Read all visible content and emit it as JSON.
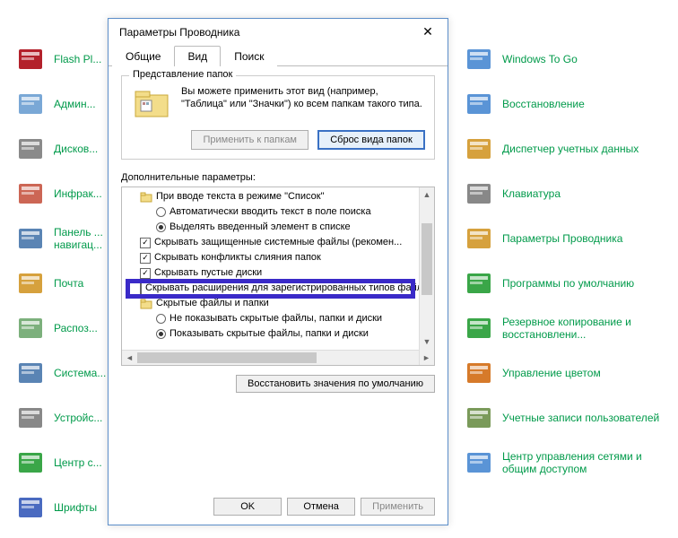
{
  "bg_left": [
    {
      "label": "Flash Pl...",
      "icon": "flash"
    },
    {
      "label": "Админ...",
      "icon": "admin"
    },
    {
      "label": "Дисков...",
      "icon": "disk"
    },
    {
      "label": "Инфрак...",
      "icon": "infra"
    },
    {
      "label": "Панель ...\nнавигац...",
      "icon": "taskbar"
    },
    {
      "label": "Почта",
      "icon": "mail"
    },
    {
      "label": "Распоз...",
      "icon": "speech"
    },
    {
      "label": "Системa...",
      "icon": "system"
    },
    {
      "label": "Устройс...",
      "icon": "device"
    },
    {
      "label": "Центр с...",
      "icon": "sync"
    },
    {
      "label": "Шрифты",
      "icon": "fonts"
    }
  ],
  "bg_right": [
    {
      "label": "Windows To Go",
      "icon": "wtg"
    },
    {
      "label": "Восстановление",
      "icon": "recovery"
    },
    {
      "label": "Диспетчер учетных данных",
      "icon": "cred"
    },
    {
      "label": "Клавиатура",
      "icon": "kbd"
    },
    {
      "label": "Параметры Проводника",
      "icon": "explorer"
    },
    {
      "label": "Программы по умолчанию",
      "icon": "default"
    },
    {
      "label": "Резервное копирование и восстановлени...",
      "icon": "backup"
    },
    {
      "label": "Управление цветом",
      "icon": "color"
    },
    {
      "label": "Учетные записи пользователей",
      "icon": "users"
    },
    {
      "label": "Центр управления сетями и общим доступом",
      "icon": "network"
    }
  ],
  "dialog": {
    "title": "Параметры Проводника",
    "tabs": [
      "Общие",
      "Вид",
      "Поиск"
    ],
    "folder_views": {
      "legend": "Представление папок",
      "text": "Вы можете применить этот вид (например, \"Таблица\" или \"Значки\") ко всем папкам такого типа.",
      "apply_btn": "Применить к папкам",
      "reset_btn": "Сброс вида папок"
    },
    "adv_label": "Дополнительные параметры:",
    "tree": [
      {
        "type": "folder",
        "indent": 1,
        "text": "При вводе текста в режиме \"Список\""
      },
      {
        "type": "radio",
        "indent": 2,
        "sel": false,
        "text": "Автоматически вводить текст в поле поиска"
      },
      {
        "type": "radio",
        "indent": 2,
        "sel": true,
        "text": "Выделять введенный элемент в списке"
      },
      {
        "type": "check",
        "indent": 1,
        "sel": true,
        "text": "Скрывать защищенные системные файлы (рекомен..."
      },
      {
        "type": "check",
        "indent": 1,
        "sel": true,
        "text": "Скрывать конфликты слияния папок"
      },
      {
        "type": "check",
        "indent": 1,
        "sel": true,
        "text": "Скрывать пустые диски"
      },
      {
        "type": "check",
        "indent": 1,
        "sel": false,
        "text": "Скрывать расширения для зарегистрированных типов файлов",
        "highlight": true
      },
      {
        "type": "folder",
        "indent": 1,
        "text": "Скрытые файлы и папки"
      },
      {
        "type": "radio",
        "indent": 2,
        "sel": false,
        "text": "Не показывать скрытые файлы, папки и диски"
      },
      {
        "type": "radio",
        "indent": 2,
        "sel": true,
        "text": "Показывать скрытые файлы, папки и диски"
      }
    ],
    "restore_btn": "Восстановить значения по умолчанию",
    "ok": "OK",
    "cancel": "Отмена",
    "apply": "Применить"
  }
}
